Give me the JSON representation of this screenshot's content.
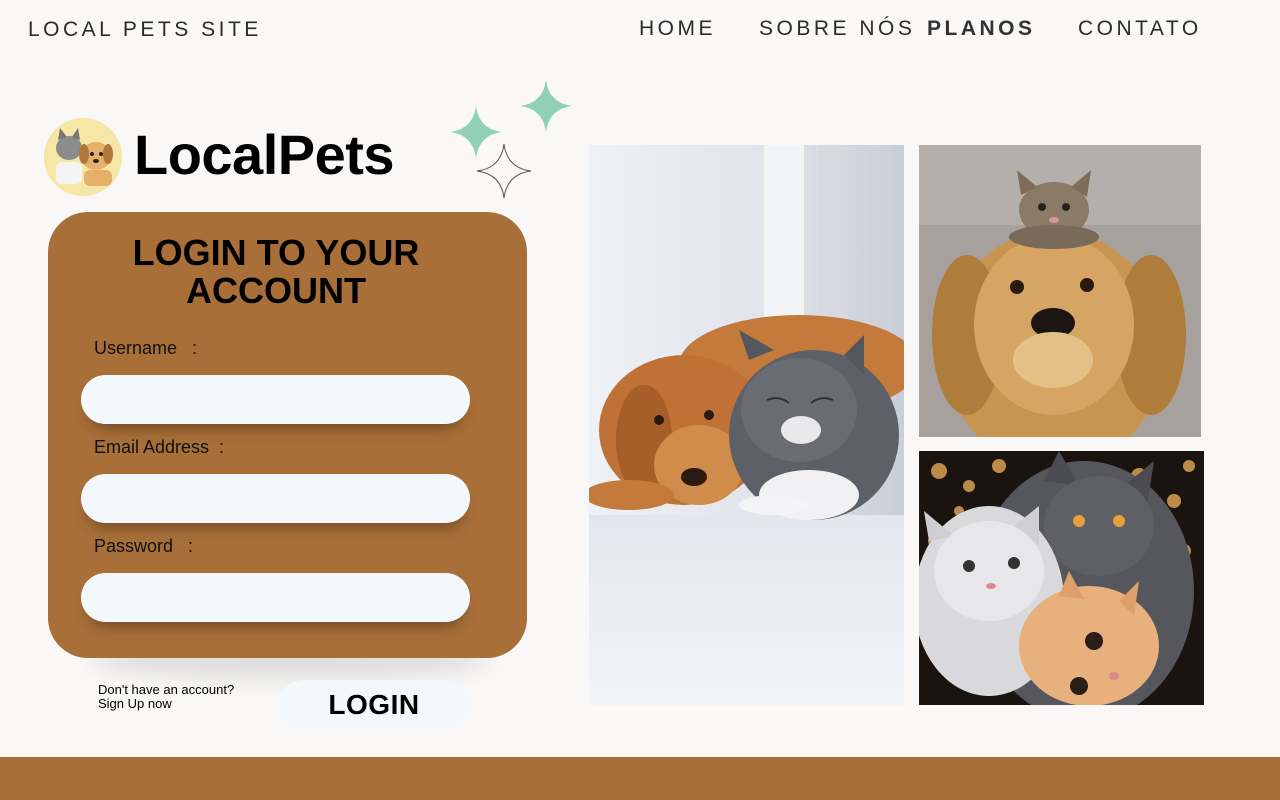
{
  "header": {
    "site_title": "LOCAL PETS SITE",
    "nav": [
      {
        "label": "HOME",
        "active": false
      },
      {
        "label": "SOBRE NÓS",
        "active": false
      },
      {
        "label": "PLANOS",
        "active": true
      },
      {
        "label": "CONTATO",
        "active": false
      }
    ]
  },
  "brand": {
    "name": "LocalPets",
    "logo_icon": "pets-logo-icon"
  },
  "login": {
    "heading": "LOGIN TO YOUR ACCOUNT",
    "fields": [
      {
        "label": "Username   :",
        "value": "",
        "placeholder": ""
      },
      {
        "label": "Email Address  :",
        "value": "",
        "placeholder": ""
      },
      {
        "label": "Password   :",
        "value": "",
        "placeholder": ""
      }
    ],
    "signup_line1": "Don't have an account?",
    "signup_line2": "Sign Up now",
    "button_label": "LOGIN"
  },
  "gallery": {
    "images": [
      "dog-and-cat-photo",
      "kitten-on-dog-photo",
      "three-cats-photo"
    ]
  },
  "colors": {
    "brand_brown": "#a86f38",
    "sparkle_green": "#8fd0b6",
    "input_bg": "#f2f8fb",
    "page_bg": "#f9f8f6"
  }
}
